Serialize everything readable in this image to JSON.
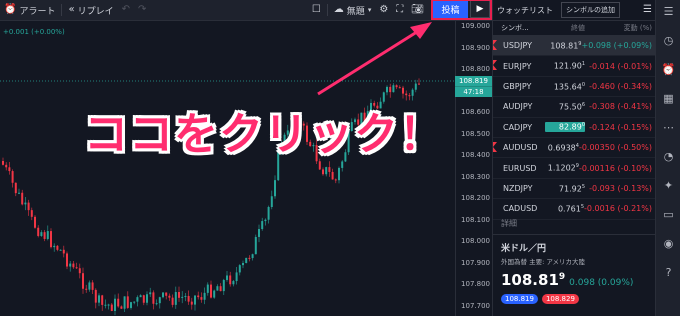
{
  "toolbar": {
    "alert_label": "アラート",
    "replay_label": "リプレイ",
    "untitled_label": "無題",
    "publish_label": "投稿"
  },
  "chart": {
    "legend_text": "+0.001 (+0.00%)",
    "price_labels": [
      "109.000",
      "108.900",
      "108.800",
      "108.700",
      "108.600",
      "108.500",
      "108.400",
      "108.300",
      "108.200",
      "108.100",
      "108.000",
      "107.900",
      "107.800",
      "107.700"
    ],
    "current_price": "108.819",
    "countdown": "47:18",
    "callout_text": "ココをクリック！"
  },
  "watchlist": {
    "tab_label": "ウォッチリスト",
    "add_symbol_label": "シンボルの追加",
    "col_symbol": "シンボ...",
    "col_last": "終値",
    "col_change": "変動 (%)",
    "rows": [
      {
        "symbol": "USDJPY",
        "last": "108.81",
        "last_sup": "9",
        "change": "+0.098 (+0.09%)",
        "dir": "pos",
        "flag": true,
        "selected": true,
        "highlight": false
      },
      {
        "symbol": "EURJPY",
        "last": "121.90",
        "last_sup": "1",
        "change": "-0.014 (-0.01%)",
        "dir": "neg",
        "flag": true,
        "selected": false,
        "highlight": false
      },
      {
        "symbol": "GBPJPY",
        "last": "135.64",
        "last_sup": "0",
        "change": "-0.460 (-0.34%)",
        "dir": "neg",
        "flag": false,
        "selected": false,
        "highlight": false
      },
      {
        "symbol": "AUDJPY",
        "last": "75.50",
        "last_sup": "6",
        "change": "-0.308 (-0.41%)",
        "dir": "neg",
        "flag": false,
        "selected": false,
        "highlight": false
      },
      {
        "symbol": "CADJPY",
        "last": "82.89",
        "last_sup": "0",
        "change": "-0.124 (-0.15%)",
        "dir": "neg",
        "flag": false,
        "selected": false,
        "highlight": true
      },
      {
        "symbol": "AUDUSD",
        "last": "0.6938",
        "last_sup": "4",
        "change": "-0.00350 (-0.50%)",
        "dir": "neg",
        "flag": true,
        "selected": false,
        "highlight": false
      },
      {
        "symbol": "EURUSD",
        "last": "1.1202",
        "last_sup": "9",
        "change": "-0.00116 (-0.10%)",
        "dir": "neg",
        "flag": false,
        "selected": false,
        "highlight": false
      },
      {
        "symbol": "NZDJPY",
        "last": "71.92",
        "last_sup": "5",
        "change": "-0.093 (-0.13%)",
        "dir": "neg",
        "flag": false,
        "selected": false,
        "highlight": false
      },
      {
        "symbol": "CADUSD",
        "last": "0.761",
        "last_sup": "5",
        "change": "-0.0016 (-0.21%)",
        "dir": "neg",
        "flag": false,
        "selected": false,
        "highlight": false
      }
    ],
    "detail": {
      "header": "詳細",
      "name": "米ドル／円",
      "sub": "外国為替 主要: アメリカ大陸",
      "price_main": "108.81",
      "price_sup": "9",
      "change": "0.098 (0.09%)",
      "bid": "108.819",
      "ask": "108.829"
    }
  },
  "colors": {
    "up": "#26a69a",
    "down": "#f23645",
    "accent": "#2962ff",
    "callout": "#ff2d6f"
  },
  "right_icons": [
    "list-icon",
    "clock-icon",
    "alarm-icon",
    "calendar-icon",
    "dots-icon",
    "chart-icon",
    "lightbulb-icon",
    "chat-icon",
    "broadcast-icon",
    "help-icon"
  ]
}
